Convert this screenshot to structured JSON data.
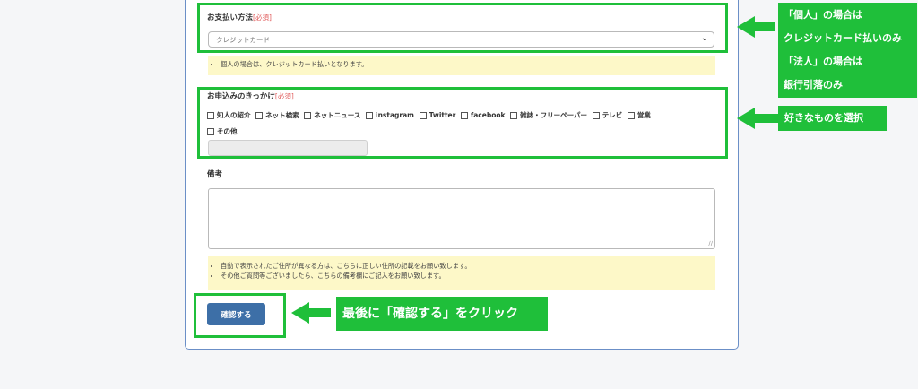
{
  "form": {
    "payment_label": "お支払い方法",
    "required_tag": "[必須]",
    "payment_value": "クレジットカード",
    "payment_note": "個人の場合は、クレジットカード払いとなります。",
    "trigger_label": "お申込みのきっかけ",
    "trigger_options": [
      "知人の紹介",
      "ネット検索",
      "ネットニュース",
      "instagram",
      "Twitter",
      "facebook",
      "雑誌・フリーペーパー",
      "テレビ",
      "営業",
      "その他"
    ],
    "remarks_label": "備考",
    "remarks_notes": [
      "自動で表示されたご住所が異なる方は、こちらに正しい住所の記載をお願い致します。",
      "その他ご質問等ございましたら、こちらの備考欄にご記入をお願い致します。"
    ],
    "submit_label": "確認する"
  },
  "callouts": {
    "payment_lines": [
      "「個人」の場合は",
      "クレジットカード払いのみ",
      "「法人」の場合は",
      "銀行引落のみ"
    ],
    "trigger": "好きなものを選択",
    "submit": "最後に「確認する」をクリック"
  },
  "colors": {
    "highlight": "#1fbf3a",
    "button": "#3d6fa7",
    "note_bg": "#fdf8c8",
    "required": "#e05a5a"
  }
}
